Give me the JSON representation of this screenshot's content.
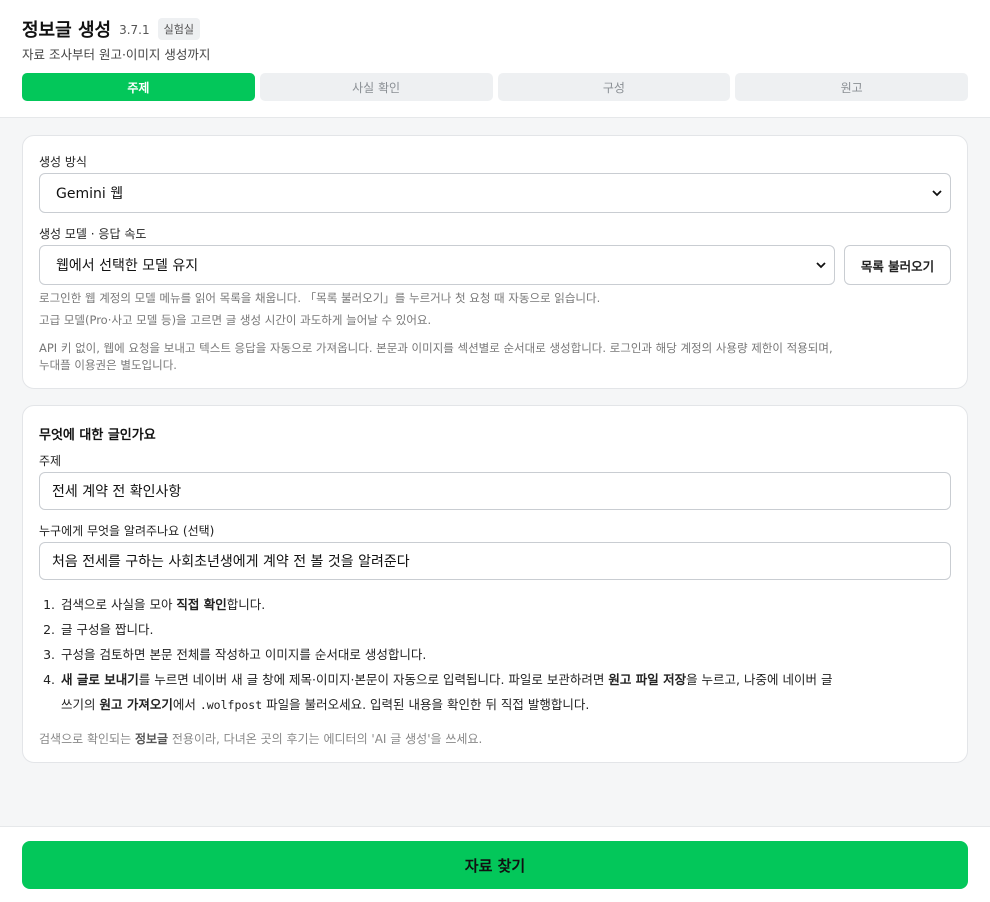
{
  "header": {
    "title": "정보글 생성",
    "version": "3.7.1",
    "badge": "실험실",
    "subtitle": "자료 조사부터 원고·이미지 생성까지"
  },
  "tabs": [
    {
      "label": "주제",
      "active": true
    },
    {
      "label": "사실 확인",
      "active": false
    },
    {
      "label": "구성",
      "active": false
    },
    {
      "label": "원고",
      "active": false
    }
  ],
  "generation": {
    "method_label": "생성 방식",
    "method_value": "Gemini 웹",
    "model_label": "생성 모델 · 응답 속도",
    "model_value": "웹에서 선택한 모델 유지",
    "load_list_button": "목록 불러오기",
    "help_line1": "로그인한 웹 계정의 모델 메뉴를 읽어 목록을 채웁니다. 「목록 불러오기」를 누르거나 첫 요청 때 자동으로 읽습니다.",
    "help_line2": "고급 모델(Pro·사고 모델 등)을 고르면 글 생성 시간이 과도하게 늘어날 수 있어요.",
    "info_line1": "API 키 없이, 웹에 요청을 보내고 텍스트 응답을 자동으로 가져옵니다. 본문과 이미지를 섹션별로 순서대로 생성합니다. 로그인과 해당 계정의 사용량 제한이 적용되며,",
    "info_line2": "누대플 이용권은 별도입니다."
  },
  "topic": {
    "section_title": "무엇에 대한 글인가요",
    "topic_label": "주제",
    "topic_value": "전세 계약 전 확인사항",
    "audience_label": "누구에게 무엇을 알려주나요 (선택)",
    "audience_value": "처음 전세를 구하는 사회초년생에게 계약 전 볼 것을 알려준다",
    "steps": {
      "s1_num": "1.",
      "s1_a": "검색으로 사실을 모아 ",
      "s1_b": "직접 확인",
      "s1_c": "합니다.",
      "s2_num": "2.",
      "s2": "글 구성을 짭니다.",
      "s3_num": "3.",
      "s3": "구성을 검토하면 본문 전체를 작성하고 이미지를 순서대로 생성합니다.",
      "s4_num": "4.",
      "s4_a": "새 글로 보내기",
      "s4_b": "를 누르면 네이버 새 글 창에 제목·이미지·본문이 자동으로 입력됩니다. 파일로 보관하려면 ",
      "s4_c": "원고 파일 저장",
      "s4_d": "을 누르고, 나중에 네이버 글",
      "s4_e": "쓰기의 ",
      "s4_f": "원고 가져오기",
      "s4_g": "에서 ",
      "s4_h": ".wolfpost",
      "s4_i": " 파일을 불러오세요. 입력된 내용을 확인한 뒤 직접 발행합니다."
    },
    "note_a": "검색으로 확인되는 ",
    "note_b": "정보글",
    "note_c": " 전용이라, 다녀온 곳의 후기는 에디터의 'AI 글 생성'을 쓰세요."
  },
  "footer": {
    "primary_button": "자료 찾기"
  },
  "colors": {
    "accent": "#03c75a",
    "border": "#c9cdd2",
    "muted_text": "#777777"
  }
}
